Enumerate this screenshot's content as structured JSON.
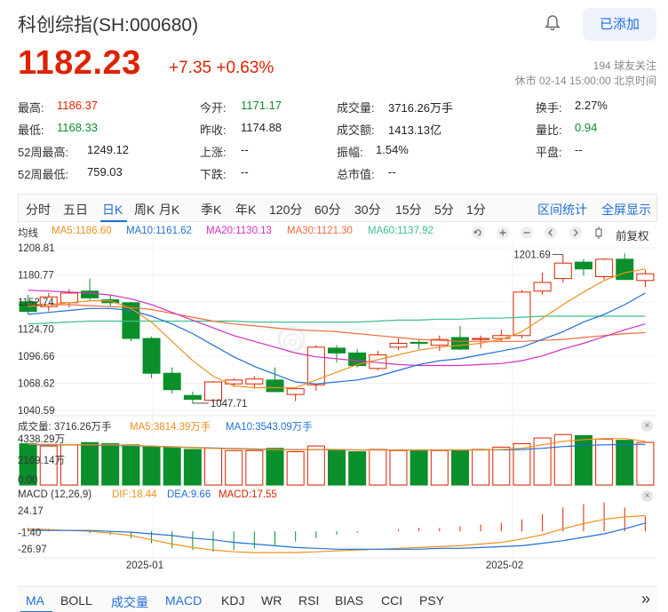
{
  "header": {
    "title": "科创综指(SH:000680)",
    "follow_label": "已添加",
    "price": "1182.23",
    "change": "+7.35 +0.63%",
    "followers": "194 球友关注",
    "market_status": "休市 02-14 15:00:00 北京时间"
  },
  "stats": [
    {
      "label": "最高:",
      "value": "1186.37",
      "color": "red"
    },
    {
      "label": "今开:",
      "value": "1171.17",
      "color": "green"
    },
    {
      "label": "成交量:",
      "value": "3716.26万手",
      "color": "dark"
    },
    {
      "label": "换手:",
      "value": "2.27%",
      "color": "dark"
    },
    {
      "label": "最低:",
      "value": "1168.33",
      "color": "green"
    },
    {
      "label": "昨收:",
      "value": "1174.88",
      "color": "dark"
    },
    {
      "label": "成交额:",
      "value": "1413.13亿",
      "color": "dark"
    },
    {
      "label": "量比:",
      "value": "0.94",
      "color": "green"
    },
    {
      "label": "52周最高:",
      "value": "1249.12",
      "color": "dark"
    },
    {
      "label": "上涨:",
      "value": "--",
      "color": "dark"
    },
    {
      "label": "振幅:",
      "value": "1.54%",
      "color": "dark"
    },
    {
      "label": "平盘:",
      "value": "--",
      "color": "dark"
    },
    {
      "label": "52周最低:",
      "value": "759.03",
      "color": "dark"
    },
    {
      "label": "下跌:",
      "value": "--",
      "color": "dark"
    },
    {
      "label": "总市值:",
      "value": "--",
      "color": "dark"
    }
  ],
  "period_tabs": [
    "分时",
    "五日",
    "日K",
    "周K",
    "月K",
    "季K",
    "年K",
    "120分",
    "60分",
    "30分",
    "15分",
    "5分",
    "1分"
  ],
  "period_active": 2,
  "period_links": {
    "stat": "区间统计",
    "full": "全屏显示"
  },
  "kline_legend": {
    "prefix": "均线",
    "ma5": "MA5:1186.60",
    "ma10": "MA10:1161.62",
    "ma20": "MA20:1130.13",
    "ma30": "MA30:1121.30",
    "ma60": "MA60:1137.92",
    "adjust": "前复权"
  },
  "colors": {
    "up": "#dd2200",
    "down": "#0a8f2a",
    "accent": "#1f6fd8",
    "ma5": "#f0901e",
    "ma10": "#1f6fd8",
    "ma20": "#d42fc0",
    "ma30": "#f26b3a",
    "ma60": "#3cbf8d",
    "dif": "#f0901e",
    "dea": "#1f6fd8",
    "macd": "#dd2200"
  },
  "price_axis": [
    "1208.81",
    "1180.77",
    "1152.74",
    "1124.70",
    "1096.66",
    "1068.62",
    "1040.59"
  ],
  "annotations": {
    "high": "1201.69",
    "low": "1047.71"
  },
  "volume_legend": {
    "vol": "成交量: 3716.26万手",
    "ma5": "MA5:3814.39万手",
    "ma10": "MA10:3543.09万手"
  },
  "volume_axis": [
    "4338.29万",
    "2169.14万",
    "0.00"
  ],
  "macd_legend": {
    "name": "MACD (12,26,9)",
    "dif": "DIF:18.44",
    "dea": "DEA:9.66",
    "macd": "MACD:17.55"
  },
  "macd_axis": [
    "24.17",
    "-1.40",
    "-26.97"
  ],
  "date_axis": [
    "2025-01",
    "2025-02"
  ],
  "indicator_tabs": [
    "MA",
    "BOLL",
    "成交量",
    "MACD",
    "KDJ",
    "WR",
    "RSI",
    "BIAS",
    "CCI",
    "PSY"
  ],
  "indicator_active": [
    0,
    2,
    3
  ],
  "chart_data": {
    "type": "candlestick",
    "price_range": [
      1040.59,
      1208.81
    ],
    "candles": [
      {
        "o": 1153,
        "h": 1160,
        "l": 1140,
        "c": 1143
      },
      {
        "o": 1148,
        "h": 1162,
        "l": 1143,
        "c": 1158
      },
      {
        "o": 1152,
        "h": 1166,
        "l": 1147,
        "c": 1162
      },
      {
        "o": 1164,
        "h": 1177,
        "l": 1155,
        "c": 1157
      },
      {
        "o": 1155,
        "h": 1160,
        "l": 1148,
        "c": 1152
      },
      {
        "o": 1152,
        "h": 1153,
        "l": 1112,
        "c": 1115
      },
      {
        "o": 1115,
        "h": 1117,
        "l": 1074,
        "c": 1079
      },
      {
        "o": 1079,
        "h": 1085,
        "l": 1058,
        "c": 1062
      },
      {
        "o": 1056,
        "h": 1060,
        "l": 1048,
        "c": 1052
      },
      {
        "o": 1051,
        "h": 1071,
        "l": 1048,
        "c": 1070
      },
      {
        "o": 1068,
        "h": 1074,
        "l": 1065,
        "c": 1072
      },
      {
        "o": 1068,
        "h": 1076,
        "l": 1063,
        "c": 1073
      },
      {
        "o": 1072,
        "h": 1085,
        "l": 1064,
        "c": 1060
      },
      {
        "o": 1057,
        "h": 1063,
        "l": 1050,
        "c": 1063
      },
      {
        "o": 1067,
        "h": 1108,
        "l": 1061,
        "c": 1106
      },
      {
        "o": 1105,
        "h": 1108,
        "l": 1090,
        "c": 1100
      },
      {
        "o": 1100,
        "h": 1104,
        "l": 1085,
        "c": 1087
      },
      {
        "o": 1084,
        "h": 1102,
        "l": 1082,
        "c": 1098
      },
      {
        "o": 1106,
        "h": 1115,
        "l": 1103,
        "c": 1110
      },
      {
        "o": 1111,
        "h": 1114,
        "l": 1104,
        "c": 1110
      },
      {
        "o": 1108,
        "h": 1118,
        "l": 1102,
        "c": 1114
      },
      {
        "o": 1116,
        "h": 1128,
        "l": 1103,
        "c": 1104
      },
      {
        "o": 1114,
        "h": 1118,
        "l": 1105,
        "c": 1115
      },
      {
        "o": 1115,
        "h": 1124,
        "l": 1112,
        "c": 1118
      },
      {
        "o": 1118,
        "h": 1165,
        "l": 1115,
        "c": 1163
      },
      {
        "o": 1164,
        "h": 1183,
        "l": 1160,
        "c": 1173
      },
      {
        "o": 1177,
        "h": 1202,
        "l": 1173,
        "c": 1193
      },
      {
        "o": 1194,
        "h": 1197,
        "l": 1180,
        "c": 1187
      },
      {
        "o": 1179,
        "h": 1198,
        "l": 1176,
        "c": 1197
      },
      {
        "o": 1197,
        "h": 1203,
        "l": 1176,
        "c": 1176
      },
      {
        "o": 1175,
        "h": 1186,
        "l": 1168,
        "c": 1182
      }
    ],
    "ma5": [
      1148,
      1150,
      1152,
      1154,
      1154,
      1146,
      1132,
      1112,
      1092,
      1076,
      1066,
      1064,
      1064,
      1064,
      1072,
      1080,
      1088,
      1093,
      1098,
      1103,
      1106,
      1108,
      1110,
      1114,
      1122,
      1136,
      1150,
      1163,
      1175,
      1183,
      1187
    ],
    "ma10": [
      1140,
      1142,
      1144,
      1146,
      1146,
      1144,
      1138,
      1130,
      1120,
      1108,
      1096,
      1086,
      1078,
      1070,
      1068,
      1070,
      1072,
      1076,
      1082,
      1088,
      1092,
      1094,
      1098,
      1102,
      1106,
      1114,
      1122,
      1132,
      1140,
      1150,
      1162
    ],
    "ma20": [
      1165,
      1164,
      1163,
      1162,
      1160,
      1156,
      1150,
      1142,
      1134,
      1126,
      1118,
      1112,
      1106,
      1100,
      1096,
      1094,
      1092,
      1090,
      1088,
      1087,
      1087,
      1087,
      1088,
      1089,
      1092,
      1097,
      1104,
      1110,
      1117,
      1124,
      1130
    ],
    "ma30": [
      1150,
      1150,
      1150,
      1149,
      1148,
      1147,
      1145,
      1141,
      1137,
      1133,
      1130,
      1128,
      1126,
      1124,
      1123,
      1122,
      1120,
      1118,
      1116,
      1114,
      1113,
      1112,
      1112,
      1112,
      1112,
      1113,
      1114,
      1116,
      1118,
      1120,
      1121
    ],
    "ma60": [
      1130,
      1131,
      1132,
      1133,
      1133,
      1133,
      1133,
      1133,
      1133,
      1133,
      1133,
      1132,
      1132,
      1132,
      1132,
      1132,
      1132,
      1133,
      1134,
      1134,
      1135,
      1135,
      1136,
      1136,
      1137,
      1138,
      1138,
      1138,
      1138,
      1138,
      1138
    ],
    "volume_max": 4338.29,
    "volume": [
      3600,
      3400,
      3500,
      3700,
      3600,
      3500,
      3300,
      3300,
      3100,
      3200,
      3000,
      3000,
      3200,
      2900,
      3400,
      3100,
      2900,
      3100,
      3000,
      3000,
      3000,
      3000,
      3100,
      3300,
      3600,
      4100,
      4400,
      4300,
      4000,
      3900,
      3716
    ],
    "volume_ma5": [
      3550,
      3550,
      3520,
      3500,
      3500,
      3450,
      3400,
      3300,
      3250,
      3200,
      3150,
      3100,
      3100,
      3050,
      3100,
      3100,
      3050,
      3050,
      3050,
      3050,
      3050,
      3050,
      3050,
      3100,
      3200,
      3500,
      3800,
      3950,
      4050,
      4050,
      3814
    ],
    "volume_ma10": [
      3500,
      3500,
      3500,
      3480,
      3460,
      3420,
      3380,
      3330,
      3280,
      3230,
      3180,
      3140,
      3100,
      3080,
      3080,
      3070,
      3060,
      3060,
      3060,
      3060,
      3060,
      3060,
      3060,
      3070,
      3100,
      3200,
      3350,
      3450,
      3500,
      3530,
      3543
    ],
    "macd_range": [
      -26.97,
      24.17
    ],
    "dif": [
      3,
      2,
      1,
      0,
      -2,
      -5,
      -10,
      -15,
      -19,
      -22,
      -24,
      -25,
      -25,
      -25,
      -24,
      -23,
      -22,
      -21,
      -20,
      -19,
      -18,
      -17,
      -15,
      -13,
      -9,
      -4,
      3,
      9,
      14,
      17,
      18.44
    ],
    "dea": [
      1,
      1,
      1,
      1,
      0,
      -1,
      -3,
      -5,
      -8,
      -10,
      -13,
      -15,
      -17,
      -19,
      -20,
      -21,
      -21,
      -21,
      -21,
      -21,
      -20,
      -20,
      -19,
      -18,
      -17,
      -14,
      -11,
      -7,
      -3,
      3,
      9.66
    ],
    "macd_hist": [
      4,
      3,
      0,
      -2,
      -4,
      -8,
      -14,
      -20,
      -22,
      -24,
      -22,
      -20,
      -16,
      -12,
      -8,
      -4,
      -2,
      0,
      2,
      4,
      4,
      6,
      8,
      10,
      14,
      20,
      28,
      32,
      34,
      28,
      17.55
    ]
  }
}
